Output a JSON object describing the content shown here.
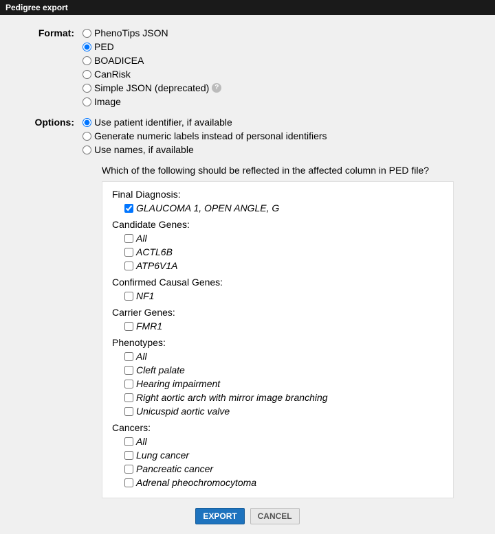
{
  "title": "Pedigree export",
  "labels": {
    "format": "Format:",
    "options": "Options:"
  },
  "formats": [
    {
      "id": "phenotips",
      "label": "PhenoTips JSON",
      "checked": false,
      "help": false
    },
    {
      "id": "ped",
      "label": "PED",
      "checked": true,
      "help": false
    },
    {
      "id": "boadicea",
      "label": "BOADICEA",
      "checked": false,
      "help": false
    },
    {
      "id": "canrisk",
      "label": "CanRisk",
      "checked": false,
      "help": false
    },
    {
      "id": "simplejson",
      "label": "Simple JSON (deprecated)",
      "checked": false,
      "help": true
    },
    {
      "id": "image",
      "label": "Image",
      "checked": false,
      "help": false
    }
  ],
  "options": [
    {
      "id": "patientid",
      "label": "Use patient identifier, if available",
      "checked": true
    },
    {
      "id": "numeric",
      "label": "Generate numeric labels instead of personal identifiers",
      "checked": false
    },
    {
      "id": "names",
      "label": "Use names, if available",
      "checked": false
    }
  ],
  "question": "Which of the following should be reflected in the affected column in PED file?",
  "groups": [
    {
      "header": "Final Diagnosis:",
      "items": [
        {
          "label": "GLAUCOMA 1, OPEN ANGLE, G",
          "checked": true
        }
      ]
    },
    {
      "header": "Candidate Genes:",
      "items": [
        {
          "label": "All",
          "checked": false
        },
        {
          "label": "ACTL6B",
          "checked": false
        },
        {
          "label": "ATP6V1A",
          "checked": false
        }
      ]
    },
    {
      "header": "Confirmed Causal Genes:",
      "items": [
        {
          "label": "NF1",
          "checked": false
        }
      ]
    },
    {
      "header": "Carrier Genes:",
      "items": [
        {
          "label": "FMR1",
          "checked": false
        }
      ]
    },
    {
      "header": "Phenotypes:",
      "items": [
        {
          "label": "All",
          "checked": false
        },
        {
          "label": "Cleft palate",
          "checked": false
        },
        {
          "label": "Hearing impairment",
          "checked": false
        },
        {
          "label": "Right aortic arch with mirror image branching",
          "checked": false
        },
        {
          "label": "Unicuspid aortic valve",
          "checked": false
        }
      ]
    },
    {
      "header": "Cancers:",
      "items": [
        {
          "label": "All",
          "checked": false
        },
        {
          "label": "Lung cancer",
          "checked": false
        },
        {
          "label": "Pancreatic cancer",
          "checked": false
        },
        {
          "label": "Adrenal pheochromocytoma",
          "checked": false
        }
      ]
    }
  ],
  "buttons": {
    "export": "EXPORT",
    "cancel": "CANCEL"
  },
  "helpGlyph": "?"
}
